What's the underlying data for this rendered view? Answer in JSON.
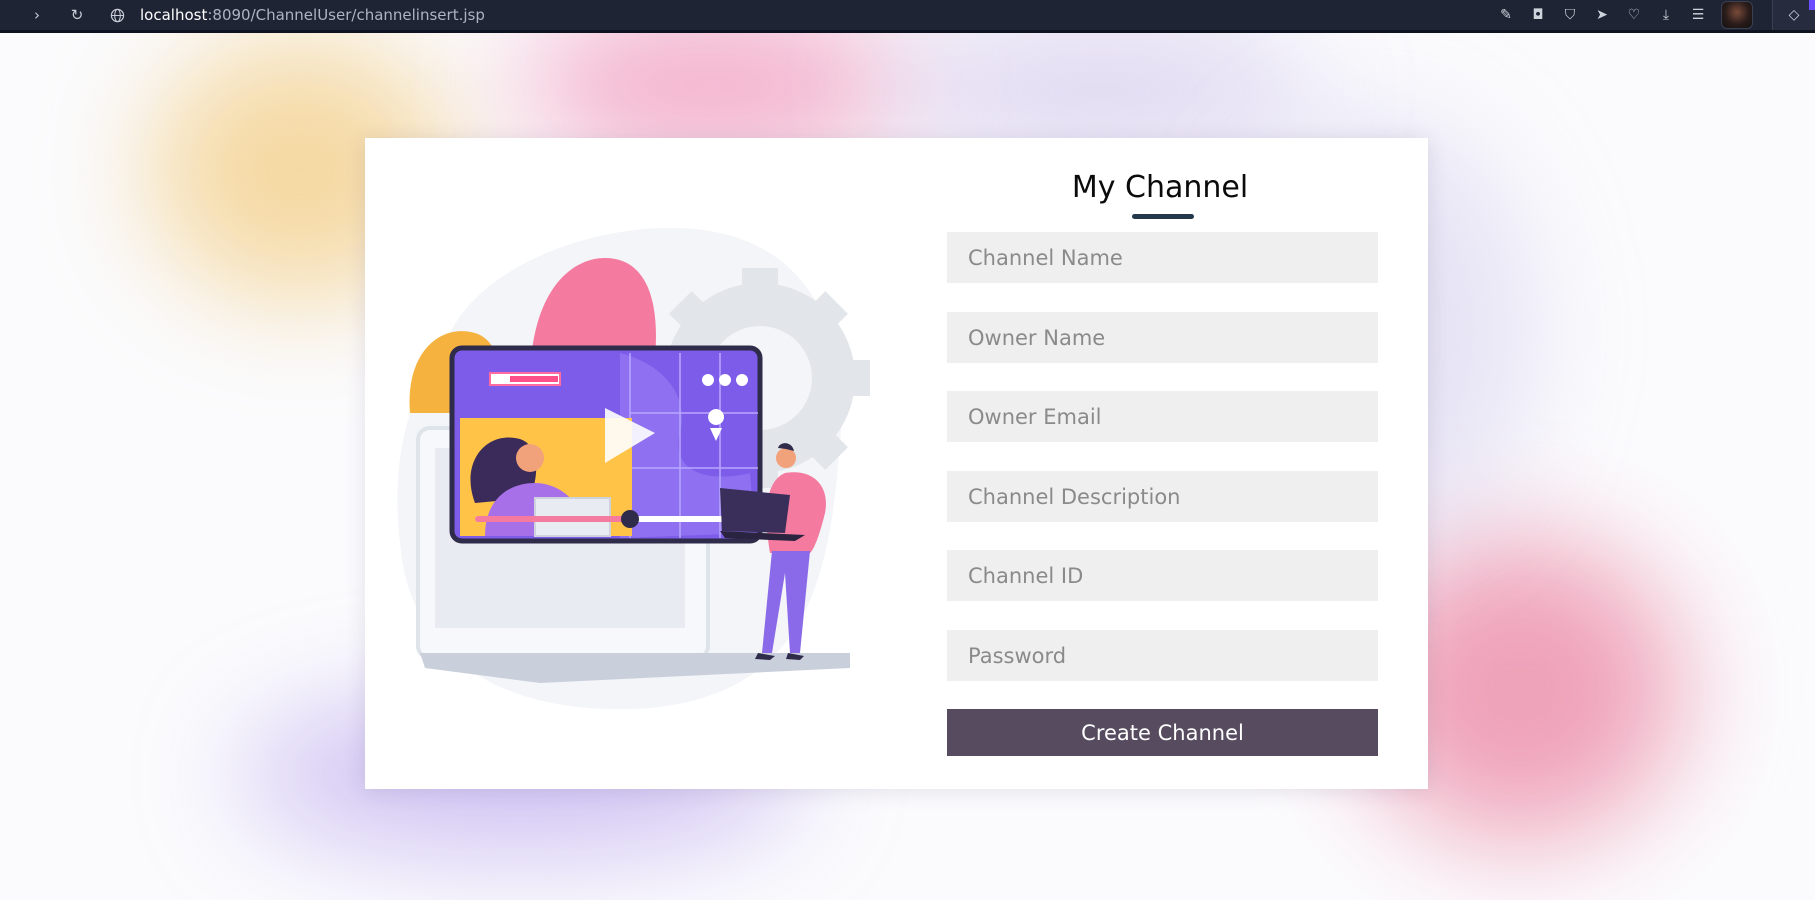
{
  "browser": {
    "url_host": "localhost",
    "url_path": ":8090/ChannelUser/channelinsert.jsp",
    "back_icon": "chevron-right-icon",
    "reload_icon": "reload-icon",
    "site_icon": "globe-icon"
  },
  "form": {
    "title": "My Channel",
    "fields": {
      "channel_name": "Channel Name",
      "owner_name": "Owner Name",
      "owner_email": "Owner Email",
      "channel_description": "Channel Description",
      "channel_id": "Channel ID",
      "password": "Password"
    },
    "submit_label": "Create Channel"
  },
  "colors": {
    "topbar": "#1f2435",
    "title_underline": "#23384a",
    "button": "#574b60",
    "field_bg": "#efefef"
  }
}
